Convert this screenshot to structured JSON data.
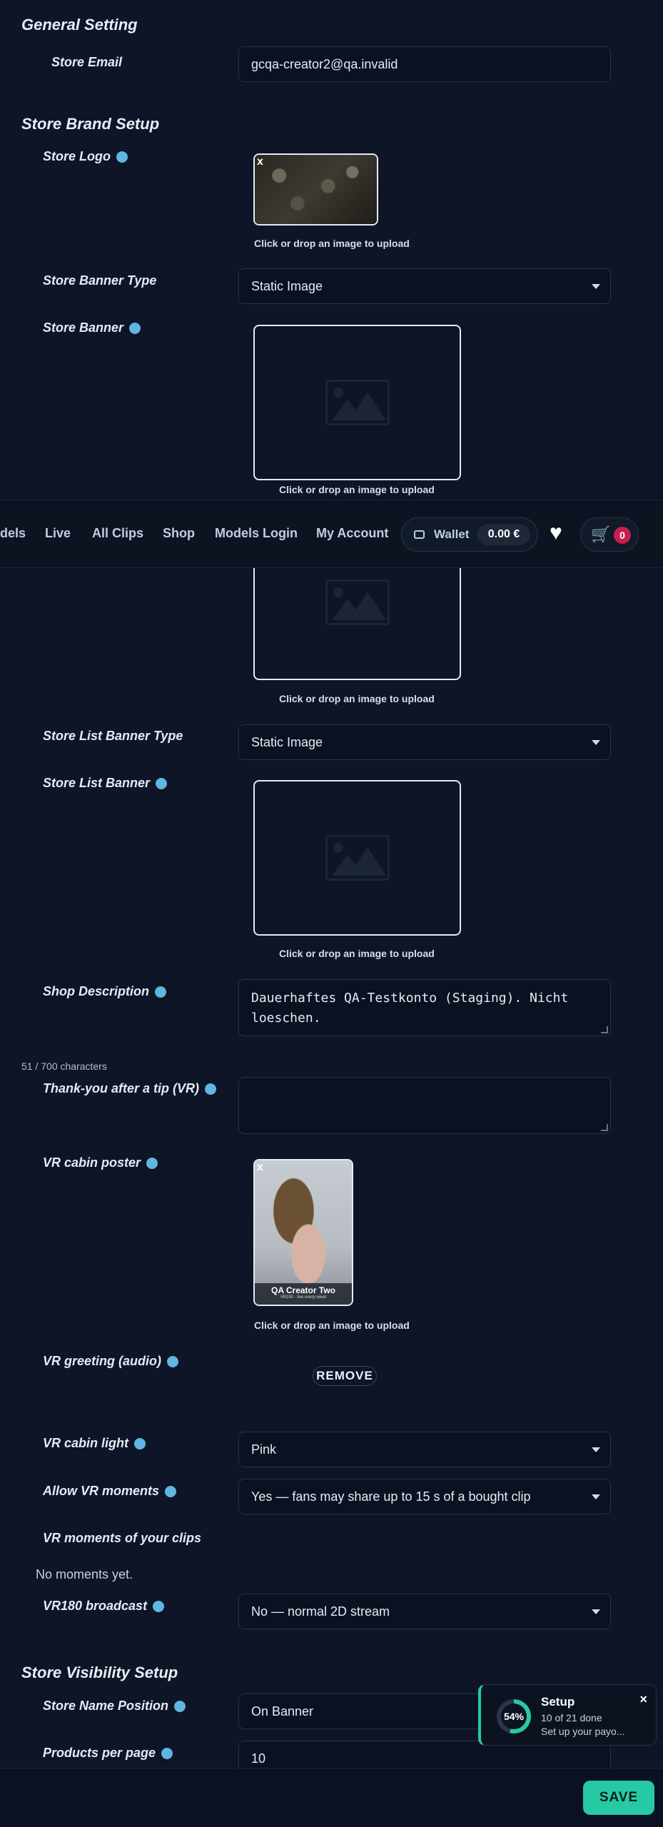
{
  "general": {
    "section_title": "General Setting",
    "store_email_label": "Store Email",
    "store_email_value": "gcqa-creator2@qa.invalid"
  },
  "brand": {
    "section_title": "Store Brand Setup",
    "logo_label": "Store Logo",
    "banner_type_label": "Store Banner Type",
    "banner_type_value": "Static Image",
    "banner_label": "Store Banner",
    "list_banner_type_label": "Store List Banner Type",
    "list_banner_type_value": "Static Image",
    "list_banner_label": "Store List Banner",
    "shop_description_label": "Shop Description",
    "shop_description_value": "Dauerhaftes QA-Testkonto (Staging). Nicht loeschen.",
    "char_count": "51 / 700 characters",
    "thank_you_label": "Thank-you after a tip (VR)",
    "thank_you_value": "",
    "vr_poster_label": "VR cabin poster",
    "vr_poster_name": "QA Creator Two",
    "vr_poster_sub": "VR180 · live every week",
    "vr_greeting_label": "VR greeting (audio)",
    "remove_label": "REMOVE",
    "vr_light_label": "VR cabin light",
    "vr_light_value": "Pink",
    "allow_moments_label": "Allow VR moments",
    "allow_moments_value": "Yes — fans may share up to 15 s of a bought clip",
    "moments_label": "VR moments of your clips",
    "moments_empty": "No moments yet.",
    "vr180_label": "VR180 broadcast",
    "vr180_value": "No — normal 2D stream"
  },
  "upload": {
    "hint": "Click or drop an image to upload",
    "close": "x"
  },
  "visibility": {
    "section_title": "Store Visibility Setup",
    "name_position_label": "Store Name Position",
    "name_position_value": "On Banner",
    "per_page_label": "Products per page",
    "per_page_value": "10"
  },
  "nav": {
    "links": [
      "dels",
      "Live",
      "All Clips",
      "Shop",
      "Models Login",
      "My Account"
    ],
    "wallet_label": "Wallet",
    "wallet_amount": "0.00 €",
    "cart_count": "0"
  },
  "toast": {
    "percent": "54%",
    "progress": 0.54,
    "title": "Setup",
    "done": "10 of 21 done",
    "next": "Set up your payo...",
    "close": "×"
  },
  "footer": {
    "save_label": "SAVE"
  },
  "colors": {
    "background": "#0d1526",
    "accent": "#27c9a4",
    "info": "#5fb6e0",
    "badge": "#c71f4c"
  }
}
